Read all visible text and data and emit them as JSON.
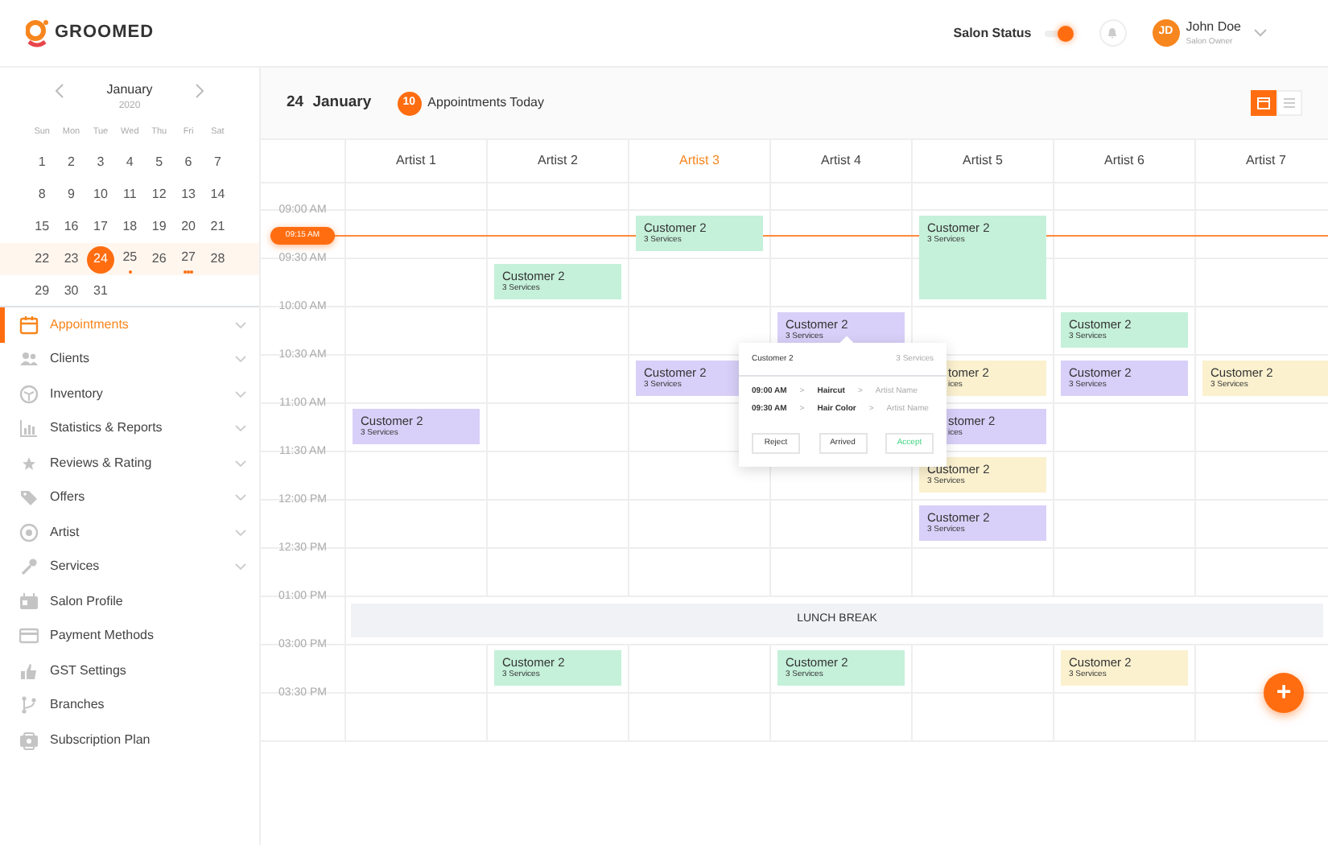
{
  "header": {
    "brand": "GROOMED",
    "salon_status": {
      "label": "Salon Status",
      "on": true
    },
    "user": {
      "initials": "JD",
      "name": "John Doe",
      "role": "Salon Owner"
    }
  },
  "mini_calendar": {
    "month": "January",
    "year": "2020",
    "weekdays": [
      "Sun",
      "Mon",
      "Tue",
      "Wed",
      "Thu",
      "Fri",
      "Sat"
    ],
    "weeks": [
      {
        "selected": false,
        "days": [
          {
            "day": "1",
            "selected": false
          },
          {
            "day": "2",
            "selected": false
          },
          {
            "day": "3",
            "selected": false
          },
          {
            "day": "4",
            "selected": false
          },
          {
            "day": "5",
            "selected": false
          },
          {
            "day": "6",
            "selected": false
          },
          {
            "day": "7",
            "selected": false
          }
        ]
      },
      {
        "selected": false,
        "days": [
          {
            "day": "8",
            "selected": false
          },
          {
            "day": "9",
            "selected": false
          },
          {
            "day": "10",
            "selected": false
          },
          {
            "day": "11",
            "selected": false
          },
          {
            "day": "12",
            "selected": false
          },
          {
            "day": "13",
            "selected": false
          },
          {
            "day": "14",
            "selected": false
          }
        ]
      },
      {
        "selected": false,
        "days": [
          {
            "day": "15",
            "selected": false
          },
          {
            "day": "16",
            "selected": false
          },
          {
            "day": "17",
            "selected": false
          },
          {
            "day": "18",
            "selected": false
          },
          {
            "day": "19",
            "selected": false
          },
          {
            "day": "20",
            "selected": false
          },
          {
            "day": "21",
            "selected": false
          }
        ]
      },
      {
        "selected": true,
        "days": [
          {
            "day": "22",
            "selected": false
          },
          {
            "day": "23",
            "selected": false
          },
          {
            "day": "24",
            "selected": true
          },
          {
            "day": "25",
            "selected": false,
            "has_events": true
          },
          {
            "day": "26",
            "selected": false
          },
          {
            "day": "27",
            "selected": false,
            "has_events": true,
            "many_events": true
          },
          {
            "day": "28",
            "selected": false
          }
        ]
      },
      {
        "selected": false,
        "days": [
          {
            "day": "29",
            "selected": false
          },
          {
            "day": "30",
            "selected": false
          },
          {
            "day": "31",
            "selected": false
          }
        ]
      }
    ]
  },
  "menu": [
    {
      "label": "Appointments",
      "selected": true,
      "expandable": true
    },
    {
      "label": "Clients",
      "selected": false,
      "expandable": true
    },
    {
      "label": "Inventory",
      "selected": false,
      "expandable": true
    },
    {
      "label": "Statistics & Reports",
      "selected": false,
      "expandable": true
    },
    {
      "label": "Reviews & Rating",
      "selected": false,
      "expandable": true
    },
    {
      "label": "Offers",
      "selected": false,
      "expandable": true
    },
    {
      "label": "Artist",
      "selected": false,
      "expandable": true
    },
    {
      "label": "Services",
      "selected": false,
      "expandable": true
    },
    {
      "label": "Salon Profile",
      "selected": false,
      "expandable": false
    },
    {
      "label": "Payment Methods",
      "selected": false,
      "expandable": false
    },
    {
      "label": "GST Settings",
      "selected": false,
      "expandable": false
    },
    {
      "label": "Branches",
      "selected": false,
      "expandable": false
    },
    {
      "label": "Subscription Plan",
      "selected": false,
      "expandable": false
    }
  ],
  "topbar": {
    "day": "24",
    "month": "January",
    "count": "10",
    "count_label": "Appointments Today",
    "views": [
      {
        "kind": "calendar",
        "selected": true
      },
      {
        "kind": "list",
        "selected": false
      }
    ]
  },
  "artists": [
    {
      "name": "Artist 1",
      "selected": false
    },
    {
      "name": "Artist 2",
      "selected": false
    },
    {
      "name": "Artist 3",
      "selected": true
    },
    {
      "name": "Artist 4",
      "selected": false
    },
    {
      "name": "Artist 5",
      "selected": false
    },
    {
      "name": "Artist 6",
      "selected": false
    },
    {
      "name": "Artist 7",
      "selected": false
    }
  ],
  "rows": [
    {
      "kind": "slot",
      "cells": [
        {},
        {},
        {},
        {},
        {},
        {},
        {}
      ]
    },
    {
      "kind": "slot",
      "time": "09:00 AM",
      "now_marker": "09:15 AM",
      "cells": [
        {},
        {},
        {
          "customer": "Customer 2",
          "services": "3 Services",
          "color": "#c5f0da",
          "kind": "short"
        },
        {},
        {
          "customer": "Customer 2",
          "services": "3 Services",
          "color": "#c5f0da",
          "kind": "long"
        },
        {},
        {}
      ]
    },
    {
      "kind": "slot",
      "time": "09:30 AM",
      "cells": [
        {},
        {
          "customer": "Customer 2",
          "services": "3 Services",
          "color": "#c5f0da",
          "kind": "short"
        },
        {},
        {},
        {},
        {},
        {}
      ]
    },
    {
      "kind": "slot",
      "time": "10:00 AM",
      "cells": [
        {},
        {},
        {},
        {
          "customer": "Customer 2",
          "services": "3 Services",
          "color": "#d8d0f8",
          "kind": "short"
        },
        {},
        {
          "customer": "Customer 2",
          "services": "3 Services",
          "color": "#c5f0da",
          "kind": "short"
        },
        {}
      ]
    },
    {
      "kind": "slot",
      "time": "10:30 AM",
      "cells": [
        {},
        {},
        {
          "customer": "Customer 2",
          "services": "3 Services",
          "color": "#d8d0f8",
          "kind": "short"
        },
        {},
        {
          "customer": "tomer 2",
          "services": "ices",
          "color": "#fbf1cf",
          "kind": "covered"
        },
        {
          "customer": "Customer 2",
          "services": "3 Services",
          "color": "#d8d0f8",
          "kind": "short"
        },
        {
          "customer": "Customer 2",
          "services": "3 Services",
          "color": "#fbf1cf",
          "kind": "short"
        }
      ]
    },
    {
      "kind": "slot",
      "time": "11:00 AM",
      "cells": [
        {
          "customer": "Customer 2",
          "services": "3 Services",
          "color": "#d8d0f8",
          "kind": "short"
        },
        {},
        {},
        {},
        {
          "customer": "stomer 2",
          "services": "ices",
          "color": "#d8d0f8",
          "kind": "covered"
        },
        {},
        {}
      ]
    },
    {
      "kind": "slot",
      "time": "11:30 AM",
      "cells": [
        {},
        {},
        {},
        {},
        {
          "customer": "Customer 2",
          "services": "3 Services",
          "color": "#fbf1cf",
          "kind": "short"
        },
        {},
        {}
      ]
    },
    {
      "kind": "slot",
      "time": "12:00 PM",
      "cells": [
        {},
        {},
        {},
        {},
        {
          "customer": "Customer 2",
          "services": "3 Services",
          "color": "#d8d0f8",
          "kind": "short"
        },
        {},
        {}
      ]
    },
    {
      "kind": "slot",
      "time": "12:30 PM",
      "cells": [
        {},
        {},
        {},
        {},
        {},
        {},
        {}
      ]
    },
    {
      "kind": "break",
      "time": "01:00 PM",
      "label": "LUNCH BREAK"
    },
    {
      "kind": "slot",
      "time": "03:00 PM",
      "cells": [
        {},
        {
          "customer": "Customer 2",
          "services": "3 Services",
          "color": "#c5f0da",
          "kind": "short"
        },
        {},
        {
          "customer": "Customer 2",
          "services": "3 Services",
          "color": "#c5f0da",
          "kind": "short"
        },
        {},
        {
          "customer": "Customer 2",
          "services": "3 Services",
          "color": "#fbf1cf",
          "kind": "short"
        },
        {}
      ]
    },
    {
      "kind": "slot",
      "time": "03:30 PM",
      "cells": [
        {},
        {},
        {},
        {},
        {},
        {},
        {}
      ]
    }
  ],
  "popover": {
    "customer": "Customer 2",
    "services": "3 Services",
    "lines": [
      {
        "time": "09:00 AM",
        "sep_1": ">",
        "service": "Haircut",
        "sep_2": ">",
        "artist": "Artist Name"
      },
      {
        "time": "09:30 AM",
        "sep_1": ">",
        "service": "Hair Color",
        "sep_2": ">",
        "artist": "Artist Name"
      }
    ],
    "buttons": [
      {
        "label": "Reject",
        "kind": "plain"
      },
      {
        "label": "Arrived",
        "kind": "plain"
      },
      {
        "label": "Accept",
        "kind": "accept"
      }
    ]
  },
  "fab": {
    "label": "+"
  }
}
